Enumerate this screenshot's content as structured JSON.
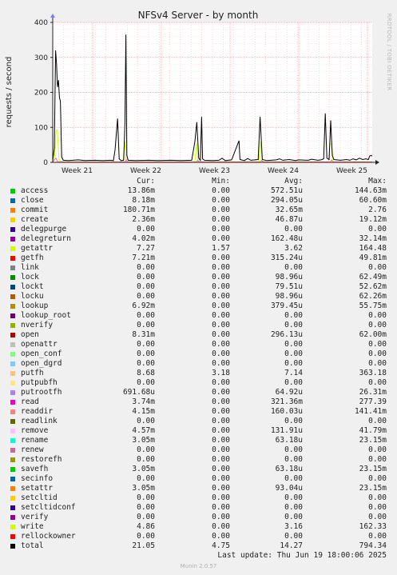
{
  "chart_data": {
    "type": "line",
    "title": "NFSv4 Server - by month",
    "ylabel": "requests / second",
    "side_text": "RRDTOOL / TOBI OETIKER",
    "ylim": [
      0,
      400
    ],
    "yticks": [
      0,
      100,
      200,
      300,
      400
    ],
    "xlim": [
      0,
      100
    ],
    "xticks": [
      {
        "label": "Week 21",
        "x": 12.5
      },
      {
        "label": "Week 22",
        "x": 34.0
      },
      {
        "label": "Week 23",
        "x": 55.5
      },
      {
        "label": "Week 24",
        "x": 77.0
      },
      {
        "label": "Week 25",
        "x": 98.5
      }
    ],
    "series": [
      {
        "name": "getattr",
        "color": "#ccff00",
        "points": [
          [
            0,
            2
          ],
          [
            0.6,
            15
          ],
          [
            1,
            85
          ],
          [
            1.4,
            95
          ],
          [
            2,
            5
          ],
          [
            3,
            2
          ],
          [
            22,
            2
          ],
          [
            22.6,
            60
          ],
          [
            23,
            4
          ],
          [
            24,
            2
          ],
          [
            44.5,
            2
          ],
          [
            45,
            55
          ],
          [
            45.5,
            2
          ],
          [
            64.5,
            2
          ],
          [
            65,
            60
          ],
          [
            65.6,
            2
          ],
          [
            86.3,
            2
          ],
          [
            86.8,
            55
          ],
          [
            87.3,
            50
          ],
          [
            87.8,
            2
          ],
          [
            100,
            2
          ]
        ]
      },
      {
        "name": "total",
        "color": "#000000",
        "points": [
          [
            0,
            5
          ],
          [
            0.5,
            40
          ],
          [
            0.9,
            320
          ],
          [
            1.2,
            280
          ],
          [
            1.5,
            215
          ],
          [
            1.8,
            235
          ],
          [
            2.1,
            185
          ],
          [
            2.4,
            175
          ],
          [
            2.8,
            15
          ],
          [
            3.3,
            6
          ],
          [
            5,
            5
          ],
          [
            8,
            7
          ],
          [
            10,
            5
          ],
          [
            13,
            6
          ],
          [
            16,
            5
          ],
          [
            18,
            6
          ],
          [
            19,
            5
          ],
          [
            19.5,
            35
          ],
          [
            20.3,
            125
          ],
          [
            20.8,
            10
          ],
          [
            21.4,
            5
          ],
          [
            22.2,
            6
          ],
          [
            22.6,
            110
          ],
          [
            22.9,
            365
          ],
          [
            23.2,
            20
          ],
          [
            23.6,
            6
          ],
          [
            26,
            5
          ],
          [
            30,
            6
          ],
          [
            33,
            5
          ],
          [
            37,
            6
          ],
          [
            40,
            5
          ],
          [
            43.5,
            6
          ],
          [
            44.5,
            60
          ],
          [
            45.1,
            115
          ],
          [
            45.7,
            12
          ],
          [
            46.2,
            6
          ],
          [
            46.6,
            130
          ],
          [
            46.9,
            10
          ],
          [
            47.5,
            6
          ],
          [
            50,
            5
          ],
          [
            52,
            6
          ],
          [
            53,
            12
          ],
          [
            54,
            5
          ],
          [
            56,
            7
          ],
          [
            58.3,
            62
          ],
          [
            58.6,
            8
          ],
          [
            60,
            5
          ],
          [
            61,
            11
          ],
          [
            62,
            6
          ],
          [
            64.3,
            8
          ],
          [
            64.9,
            130
          ],
          [
            65.6,
            8
          ],
          [
            67,
            5
          ],
          [
            70,
            7
          ],
          [
            71,
            10
          ],
          [
            72,
            6
          ],
          [
            74,
            8
          ],
          [
            76,
            5
          ],
          [
            77,
            7
          ],
          [
            80,
            6
          ],
          [
            81,
            9
          ],
          [
            83,
            6
          ],
          [
            84,
            7
          ],
          [
            84.8,
            10
          ],
          [
            85.3,
            140
          ],
          [
            85.8,
            12
          ],
          [
            86.5,
            8
          ],
          [
            87,
            120
          ],
          [
            87.5,
            20
          ],
          [
            88,
            8
          ],
          [
            90,
            6
          ],
          [
            92,
            8
          ],
          [
            93,
            6
          ],
          [
            94,
            10
          ],
          [
            95,
            7
          ],
          [
            96,
            12
          ],
          [
            97,
            8
          ],
          [
            98,
            10
          ],
          [
            98.8,
            8
          ],
          [
            99.2,
            18
          ],
          [
            99.6,
            20
          ],
          [
            100,
            18
          ]
        ]
      },
      {
        "name": "putrootfh",
        "color": "#ff66aa",
        "points": [
          [
            0,
            1
          ],
          [
            1,
            12
          ],
          [
            1.6,
            1
          ],
          [
            22.7,
            1
          ],
          [
            23,
            8
          ],
          [
            23.4,
            1
          ],
          [
            45,
            1
          ],
          [
            45.4,
            6
          ],
          [
            45.8,
            1
          ],
          [
            65,
            1
          ],
          [
            65.4,
            6
          ],
          [
            65.8,
            1
          ],
          [
            86.9,
            1
          ],
          [
            87.3,
            7
          ],
          [
            87.7,
            1
          ],
          [
            100,
            1
          ]
        ]
      }
    ],
    "legend_headers": [
      "Cur:",
      "Min:",
      "Avg:",
      "Max:"
    ],
    "legend": [
      {
        "name": "access",
        "color": "#00cc00",
        "cur": "13.86m",
        "min": "0.00",
        "avg": "572.51u",
        "max": "144.63m"
      },
      {
        "name": "close",
        "color": "#0066b3",
        "cur": "8.18m",
        "min": "0.00",
        "avg": "294.05u",
        "max": "60.60m"
      },
      {
        "name": "commit",
        "color": "#ff8000",
        "cur": "180.71m",
        "min": "0.00",
        "avg": "32.65m",
        "max": "2.76"
      },
      {
        "name": "create",
        "color": "#ffcc00",
        "cur": "2.36m",
        "min": "0.00",
        "avg": "46.87u",
        "max": "19.12m"
      },
      {
        "name": "delegpurge",
        "color": "#330099",
        "cur": "0.00",
        "min": "0.00",
        "avg": "0.00",
        "max": "0.00"
      },
      {
        "name": "delegreturn",
        "color": "#990099",
        "cur": "4.02m",
        "min": "0.00",
        "avg": "162.48u",
        "max": "32.14m"
      },
      {
        "name": "getattr",
        "color": "#ccff00",
        "cur": "7.27",
        "min": "1.57",
        "avg": "3.62",
        "max": "164.48"
      },
      {
        "name": "getfh",
        "color": "#ff0000",
        "cur": "7.21m",
        "min": "0.00",
        "avg": "315.24u",
        "max": "49.81m"
      },
      {
        "name": "link",
        "color": "#808080",
        "cur": "0.00",
        "min": "0.00",
        "avg": "0.00",
        "max": "0.00"
      },
      {
        "name": "lock",
        "color": "#008f00",
        "cur": "0.00",
        "min": "0.00",
        "avg": "98.96u",
        "max": "62.49m"
      },
      {
        "name": "lockt",
        "color": "#00487d",
        "cur": "0.00",
        "min": "0.00",
        "avg": "79.51u",
        "max": "52.62m"
      },
      {
        "name": "locku",
        "color": "#b35a00",
        "cur": "0.00",
        "min": "0.00",
        "avg": "98.96u",
        "max": "62.26m"
      },
      {
        "name": "lookup",
        "color": "#b38f00",
        "cur": "6.92m",
        "min": "0.00",
        "avg": "379.45u",
        "max": "55.75m"
      },
      {
        "name": "lookup_root",
        "color": "#6b006b",
        "cur": "0.00",
        "min": "0.00",
        "avg": "0.00",
        "max": "0.00"
      },
      {
        "name": "nverify",
        "color": "#8fb300",
        "cur": "0.00",
        "min": "0.00",
        "avg": "0.00",
        "max": "0.00"
      },
      {
        "name": "open",
        "color": "#b30000",
        "cur": "8.31m",
        "min": "0.00",
        "avg": "296.13u",
        "max": "62.00m"
      },
      {
        "name": "openattr",
        "color": "#bebebe",
        "cur": "0.00",
        "min": "0.00",
        "avg": "0.00",
        "max": "0.00"
      },
      {
        "name": "open_conf",
        "color": "#80ff80",
        "cur": "0.00",
        "min": "0.00",
        "avg": "0.00",
        "max": "0.00"
      },
      {
        "name": "open_dgrd",
        "color": "#80c9ff",
        "cur": "0.00",
        "min": "0.00",
        "avg": "0.00",
        "max": "0.00"
      },
      {
        "name": "putfh",
        "color": "#ffc080",
        "cur": "8.68",
        "min": "3.18",
        "avg": "7.14",
        "max": "363.18"
      },
      {
        "name": "putpubfh",
        "color": "#ffe680",
        "cur": "0.00",
        "min": "0.00",
        "avg": "0.00",
        "max": "0.00"
      },
      {
        "name": "putrootfh",
        "color": "#aa80ff",
        "cur": "691.68u",
        "min": "0.00",
        "avg": "64.92u",
        "max": "26.31m"
      },
      {
        "name": "read",
        "color": "#ee00cc",
        "cur": "3.74m",
        "min": "0.00",
        "avg": "321.36m",
        "max": "277.39"
      },
      {
        "name": "readdir",
        "color": "#ff8080",
        "cur": "4.15m",
        "min": "0.00",
        "avg": "160.03u",
        "max": "141.41m"
      },
      {
        "name": "readlink",
        "color": "#666600",
        "cur": "0.00",
        "min": "0.00",
        "avg": "0.00",
        "max": "0.00"
      },
      {
        "name": "remove",
        "color": "#ffbfff",
        "cur": "4.57m",
        "min": "0.00",
        "avg": "131.91u",
        "max": "41.79m"
      },
      {
        "name": "rename",
        "color": "#00ffcc",
        "cur": "3.05m",
        "min": "0.00",
        "avg": "63.18u",
        "max": "23.15m"
      },
      {
        "name": "renew",
        "color": "#cc6699",
        "cur": "0.00",
        "min": "0.00",
        "avg": "0.00",
        "max": "0.00"
      },
      {
        "name": "restorefh",
        "color": "#999900",
        "cur": "0.00",
        "min": "0.00",
        "avg": "0.00",
        "max": "0.00"
      },
      {
        "name": "savefh",
        "color": "#00cc00",
        "cur": "3.05m",
        "min": "0.00",
        "avg": "63.18u",
        "max": "23.15m"
      },
      {
        "name": "secinfo",
        "color": "#0066b3",
        "cur": "0.00",
        "min": "0.00",
        "avg": "0.00",
        "max": "0.00"
      },
      {
        "name": "setattr",
        "color": "#ff8000",
        "cur": "3.05m",
        "min": "0.00",
        "avg": "93.04u",
        "max": "23.15m"
      },
      {
        "name": "setcltid",
        "color": "#ffcc00",
        "cur": "0.00",
        "min": "0.00",
        "avg": "0.00",
        "max": "0.00"
      },
      {
        "name": "setcltidconf",
        "color": "#330099",
        "cur": "0.00",
        "min": "0.00",
        "avg": "0.00",
        "max": "0.00"
      },
      {
        "name": "verify",
        "color": "#990099",
        "cur": "0.00",
        "min": "0.00",
        "avg": "0.00",
        "max": "0.00"
      },
      {
        "name": "write",
        "color": "#ccff00",
        "cur": "4.86",
        "min": "0.00",
        "avg": "3.16",
        "max": "162.33"
      },
      {
        "name": "rellockowner",
        "color": "#ff0000",
        "cur": "0.00",
        "min": "0.00",
        "avg": "0.00",
        "max": "0.00"
      },
      {
        "name": "total",
        "color": "#000000",
        "cur": "21.05",
        "min": "4.75",
        "avg": "14.27",
        "max": "794.34"
      }
    ],
    "grid": true
  },
  "footer": {
    "last_update": "Last update: Thu Jun 19 18:00:06 2025",
    "version": "Munin 2.0.57"
  }
}
